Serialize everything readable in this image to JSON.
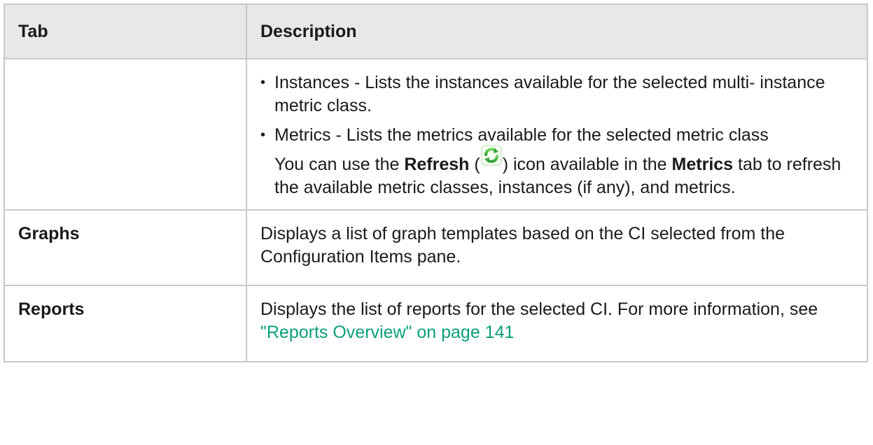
{
  "table": {
    "headers": {
      "tab": "Tab",
      "description": "Description"
    },
    "metrics_row": {
      "bullets": [
        "Instances - Lists the instances available for the selected multi- instance metric class.",
        "Metrics - Lists the metrics available for the selected metric class"
      ],
      "note": {
        "prefix": "You can use the ",
        "refresh_bold": "Refresh",
        "open_paren": " (",
        "close_paren_text": ") icon available in the ",
        "metrics_bold": "Metrics",
        "suffix": " tab to refresh the available metric classes, instances (if any), and metrics."
      },
      "bullet_glyph": "•"
    },
    "graphs_row": {
      "tab": "Graphs",
      "description": "Displays a list of graph templates based on the CI selected from the Configuration Items pane."
    },
    "reports_row": {
      "tab": "Reports",
      "description_prefix": "Displays the list of reports for the selected CI. For more information, see ",
      "link_text": "\"Reports Overview\" on page 141"
    }
  },
  "icons": {
    "refresh": "refresh-icon"
  },
  "colors": {
    "header_bg": "#e8e8e8",
    "border": "#c8c8c8",
    "link": "#0aa07a",
    "icon_green": "#3aa63a"
  }
}
